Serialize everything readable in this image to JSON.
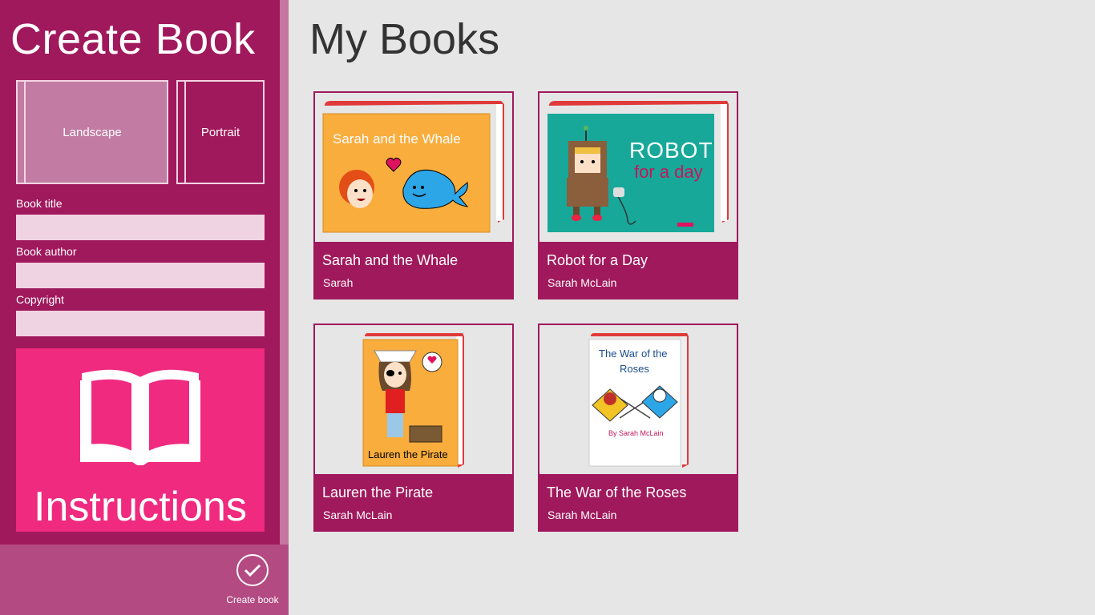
{
  "sidebar": {
    "title": "Create Book",
    "orientation": {
      "landscape": "Landscape",
      "portrait": "Portrait"
    },
    "fields": {
      "title_label": "Book title",
      "author_label": "Book author",
      "copyright_label": "Copyright",
      "title_value": "",
      "author_value": "",
      "copyright_value": ""
    },
    "instructions_label": "Instructions",
    "create_label": "Create book"
  },
  "main": {
    "title": "My Books",
    "books": [
      {
        "title": "Sarah and the Whale",
        "author": "Sarah",
        "cover_text": "Sarah and the Whale"
      },
      {
        "title": "Robot for a Day",
        "author": "Sarah McLain",
        "cover_text_1": "ROBOT",
        "cover_text_2": "for a day"
      },
      {
        "title": "Lauren the Pirate",
        "author": "Sarah McLain",
        "cover_text": "Lauren the Pirate"
      },
      {
        "title": "The War of the Roses",
        "author": "Sarah McLain",
        "cover_text_1": "The War of the",
        "cover_text_2": "Roses",
        "cover_byline": "By Sarah McLain"
      }
    ]
  },
  "colors": {
    "pane": "#a0195c",
    "accent": "#ef2a7f",
    "background": "#e6e6e6"
  }
}
